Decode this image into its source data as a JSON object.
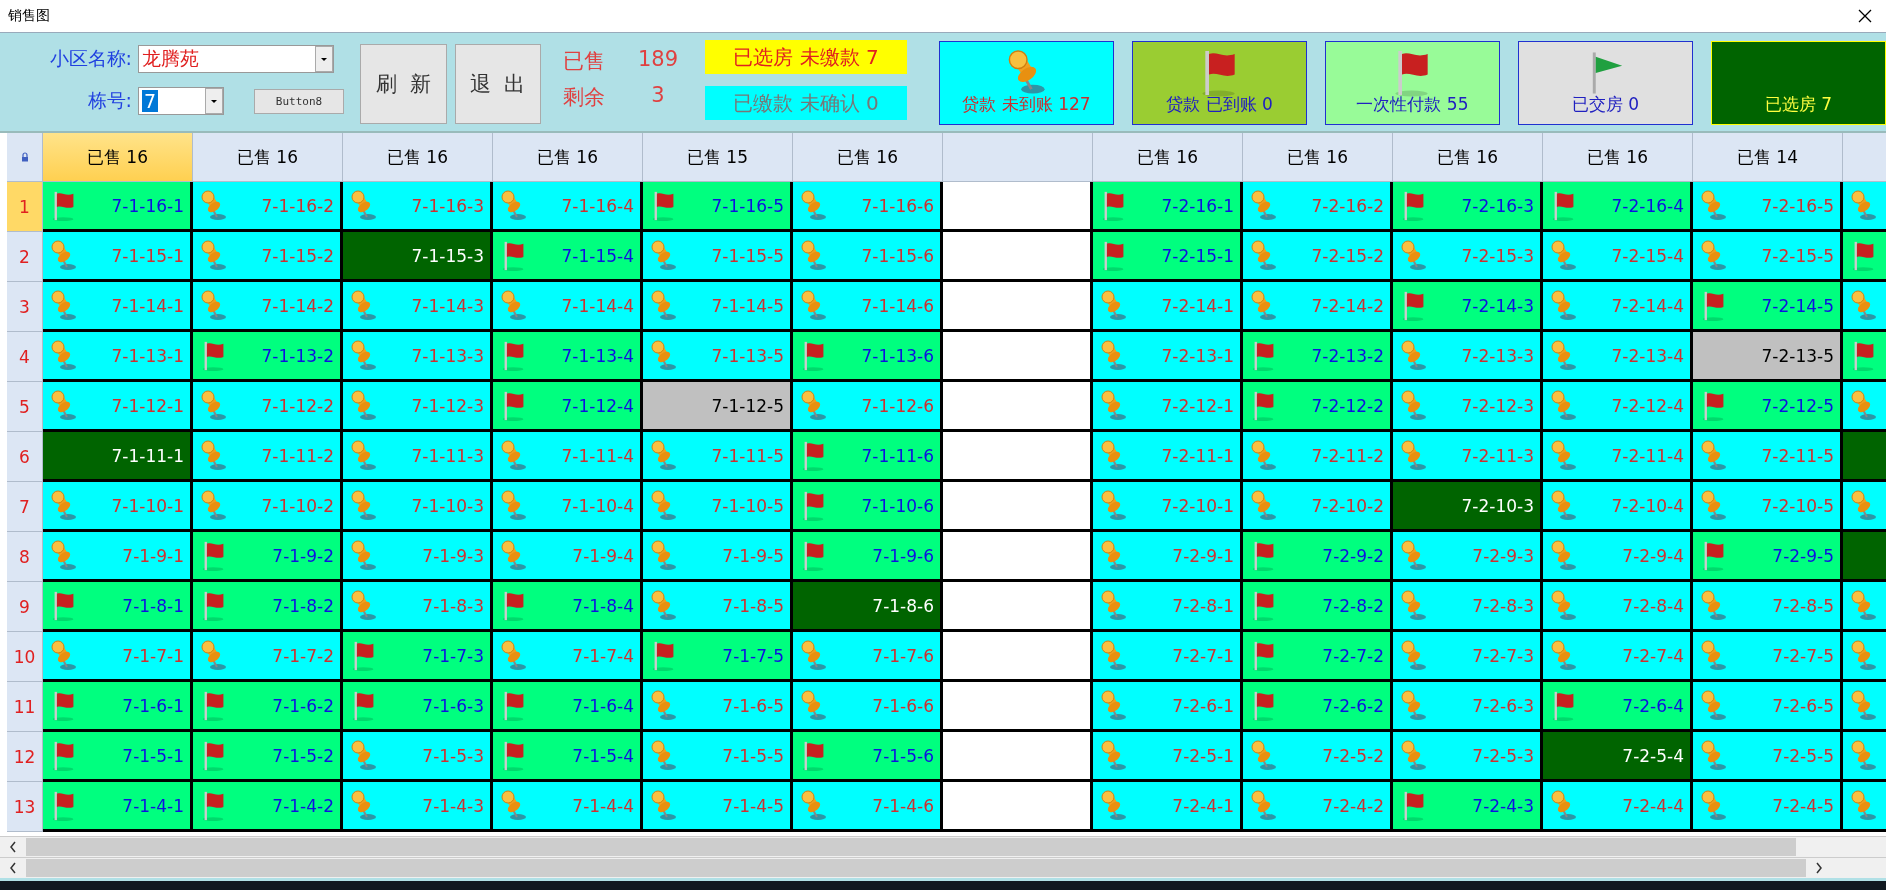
{
  "window": {
    "title": "销售图"
  },
  "toolbar": {
    "community": {
      "label": "小区名称:",
      "value": "龙腾苑"
    },
    "building": {
      "label": "栋号:",
      "value": "7",
      "focused": true
    },
    "buttons": [
      {
        "kind": "small",
        "label": "Button8"
      },
      {
        "kind": "large",
        "label": "刷 新"
      },
      {
        "kind": "large",
        "label": "退 出"
      }
    ],
    "stats": [
      {
        "label": "已售",
        "value": "189"
      },
      {
        "label": "剩余",
        "value": "3"
      }
    ],
    "notices": [
      {
        "kind": "unpaid",
        "text": "已选房 未缴款 7"
      },
      {
        "kind": "unconfirmed",
        "text": "已缴款 未确认 0"
      }
    ],
    "legend": [
      {
        "kind": "pin",
        "text": "贷款 未到账 127"
      },
      {
        "kind": "loanflag",
        "text": "贷款 已到账 0"
      },
      {
        "kind": "flag",
        "text": "一次性付款 55"
      },
      {
        "kind": "handed",
        "text": "已交房 0"
      },
      {
        "kind": "chosen",
        "text": "已选房 7"
      }
    ]
  },
  "grid": {
    "columns": [
      {
        "label": "已售 16",
        "selected": true
      },
      {
        "label": "已售 16",
        "selected": false
      },
      {
        "label": "已售 16",
        "selected": false
      },
      {
        "label": "已售 16",
        "selected": false
      },
      {
        "label": "已售 15",
        "selected": false
      },
      {
        "label": "已售 16",
        "selected": false
      },
      {
        "selected": false
      },
      {
        "label": "已售 16",
        "selected": false
      },
      {
        "label": "已售 16",
        "selected": false
      },
      {
        "label": "已售 16",
        "selected": false
      },
      {
        "label": "已售 16",
        "selected": false
      },
      {
        "label": "已售 14",
        "selected": false
      },
      {
        "selected": false
      }
    ],
    "rows": [
      {
        "number": "1",
        "selected": true,
        "cells": [
          {
            "kind": "flag",
            "label": "7-1-16-1"
          },
          {
            "kind": "pin",
            "label": "7-1-16-2"
          },
          {
            "kind": "pin",
            "label": "7-1-16-3"
          },
          {
            "kind": "pin",
            "label": "7-1-16-4"
          },
          {
            "kind": "flag",
            "label": "7-1-16-5"
          },
          {
            "kind": "pin",
            "label": "7-1-16-6"
          },
          {
            "kind": "empty"
          },
          {
            "kind": "flag",
            "label": "7-2-16-1"
          },
          {
            "kind": "pin",
            "label": "7-2-16-2"
          },
          {
            "kind": "flag",
            "label": "7-2-16-3"
          },
          {
            "kind": "flag",
            "label": "7-2-16-4"
          },
          {
            "kind": "pin",
            "label": "7-2-16-5"
          },
          {
            "kind": "pin"
          }
        ]
      },
      {
        "number": "2",
        "selected": false,
        "cells": [
          {
            "kind": "pin",
            "label": "7-1-15-1"
          },
          {
            "kind": "pin",
            "label": "7-1-15-2"
          },
          {
            "kind": "chosen",
            "label": "7-1-15-3"
          },
          {
            "kind": "flag",
            "label": "7-1-15-4"
          },
          {
            "kind": "pin",
            "label": "7-1-15-5"
          },
          {
            "kind": "pin",
            "label": "7-1-15-6"
          },
          {
            "kind": "empty"
          },
          {
            "kind": "flag",
            "label": "7-2-15-1"
          },
          {
            "kind": "pin",
            "label": "7-2-15-2"
          },
          {
            "kind": "pin",
            "label": "7-2-15-3"
          },
          {
            "kind": "pin",
            "label": "7-2-15-4"
          },
          {
            "kind": "pin",
            "label": "7-2-15-5"
          },
          {
            "kind": "flag"
          }
        ]
      },
      {
        "number": "3",
        "selected": false,
        "cells": [
          {
            "kind": "pin",
            "label": "7-1-14-1"
          },
          {
            "kind": "pin",
            "label": "7-1-14-2"
          },
          {
            "kind": "pin",
            "label": "7-1-14-3"
          },
          {
            "kind": "pin",
            "label": "7-1-14-4"
          },
          {
            "kind": "pin",
            "label": "7-1-14-5"
          },
          {
            "kind": "pin",
            "label": "7-1-14-6"
          },
          {
            "kind": "empty"
          },
          {
            "kind": "pin",
            "label": "7-2-14-1"
          },
          {
            "kind": "pin",
            "label": "7-2-14-2"
          },
          {
            "kind": "flag",
            "label": "7-2-14-3"
          },
          {
            "kind": "pin",
            "label": "7-2-14-4"
          },
          {
            "kind": "flag",
            "label": "7-2-14-5"
          },
          {
            "kind": "pin"
          }
        ]
      },
      {
        "number": "4",
        "selected": false,
        "cells": [
          {
            "kind": "pin",
            "label": "7-1-13-1"
          },
          {
            "kind": "flag",
            "label": "7-1-13-2"
          },
          {
            "kind": "pin",
            "label": "7-1-13-3"
          },
          {
            "kind": "flag",
            "label": "7-1-13-4"
          },
          {
            "kind": "pin",
            "label": "7-1-13-5"
          },
          {
            "kind": "flag",
            "label": "7-1-13-6"
          },
          {
            "kind": "empty"
          },
          {
            "kind": "pin",
            "label": "7-2-13-1"
          },
          {
            "kind": "flag",
            "label": "7-2-13-2"
          },
          {
            "kind": "pin",
            "label": "7-2-13-3"
          },
          {
            "kind": "pin",
            "label": "7-2-13-4"
          },
          {
            "kind": "grey",
            "label": "7-2-13-5"
          },
          {
            "kind": "flag"
          }
        ]
      },
      {
        "number": "5",
        "selected": false,
        "cells": [
          {
            "kind": "pin",
            "label": "7-1-12-1"
          },
          {
            "kind": "pin",
            "label": "7-1-12-2"
          },
          {
            "kind": "pin",
            "label": "7-1-12-3"
          },
          {
            "kind": "flag",
            "label": "7-1-12-4"
          },
          {
            "kind": "grey",
            "label": "7-1-12-5"
          },
          {
            "kind": "pin",
            "label": "7-1-12-6"
          },
          {
            "kind": "empty"
          },
          {
            "kind": "pin",
            "label": "7-2-12-1"
          },
          {
            "kind": "flag",
            "label": "7-2-12-2"
          },
          {
            "kind": "pin",
            "label": "7-2-12-3"
          },
          {
            "kind": "pin",
            "label": "7-2-12-4"
          },
          {
            "kind": "flag",
            "label": "7-2-12-5"
          },
          {
            "kind": "pin"
          }
        ]
      },
      {
        "number": "6",
        "selected": false,
        "cells": [
          {
            "kind": "chosen",
            "label": "7-1-11-1"
          },
          {
            "kind": "pin",
            "label": "7-1-11-2"
          },
          {
            "kind": "pin",
            "label": "7-1-11-3"
          },
          {
            "kind": "pin",
            "label": "7-1-11-4"
          },
          {
            "kind": "pin",
            "label": "7-1-11-5"
          },
          {
            "kind": "flag",
            "label": "7-1-11-6"
          },
          {
            "kind": "empty"
          },
          {
            "kind": "pin",
            "label": "7-2-11-1"
          },
          {
            "kind": "pin",
            "label": "7-2-11-2"
          },
          {
            "kind": "pin",
            "label": "7-2-11-3"
          },
          {
            "kind": "pin",
            "label": "7-2-11-4"
          },
          {
            "kind": "pin",
            "label": "7-2-11-5"
          },
          {
            "kind": "chosen"
          }
        ]
      },
      {
        "number": "7",
        "selected": false,
        "cells": [
          {
            "kind": "pin",
            "label": "7-1-10-1"
          },
          {
            "kind": "pin",
            "label": "7-1-10-2"
          },
          {
            "kind": "pin",
            "label": "7-1-10-3"
          },
          {
            "kind": "pin",
            "label": "7-1-10-4"
          },
          {
            "kind": "pin",
            "label": "7-1-10-5"
          },
          {
            "kind": "flag",
            "label": "7-1-10-6"
          },
          {
            "kind": "empty"
          },
          {
            "kind": "pin",
            "label": "7-2-10-1"
          },
          {
            "kind": "pin",
            "label": "7-2-10-2"
          },
          {
            "kind": "chosen",
            "label": "7-2-10-3"
          },
          {
            "kind": "pin",
            "label": "7-2-10-4"
          },
          {
            "kind": "pin",
            "label": "7-2-10-5"
          },
          {
            "kind": "pin"
          }
        ]
      },
      {
        "number": "8",
        "selected": false,
        "cells": [
          {
            "kind": "pin",
            "label": "7-1-9-1"
          },
          {
            "kind": "flag",
            "label": "7-1-9-2"
          },
          {
            "kind": "pin",
            "label": "7-1-9-3"
          },
          {
            "kind": "pin",
            "label": "7-1-9-4"
          },
          {
            "kind": "pin",
            "label": "7-1-9-5"
          },
          {
            "kind": "flag",
            "label": "7-1-9-6"
          },
          {
            "kind": "empty"
          },
          {
            "kind": "pin",
            "label": "7-2-9-1"
          },
          {
            "kind": "flag",
            "label": "7-2-9-2"
          },
          {
            "kind": "pin",
            "label": "7-2-9-3"
          },
          {
            "kind": "pin",
            "label": "7-2-9-4"
          },
          {
            "kind": "flag",
            "label": "7-2-9-5"
          },
          {
            "kind": "chosen"
          }
        ]
      },
      {
        "number": "9",
        "selected": false,
        "cells": [
          {
            "kind": "flag",
            "label": "7-1-8-1"
          },
          {
            "kind": "flag",
            "label": "7-1-8-2"
          },
          {
            "kind": "pin",
            "label": "7-1-8-3"
          },
          {
            "kind": "flag",
            "label": "7-1-8-4"
          },
          {
            "kind": "pin",
            "label": "7-1-8-5"
          },
          {
            "kind": "chosen",
            "label": "7-1-8-6"
          },
          {
            "kind": "empty"
          },
          {
            "kind": "pin",
            "label": "7-2-8-1"
          },
          {
            "kind": "flag",
            "label": "7-2-8-2"
          },
          {
            "kind": "pin",
            "label": "7-2-8-3"
          },
          {
            "kind": "pin",
            "label": "7-2-8-4"
          },
          {
            "kind": "pin",
            "label": "7-2-8-5"
          },
          {
            "kind": "pin"
          }
        ]
      },
      {
        "number": "10",
        "selected": false,
        "cells": [
          {
            "kind": "pin",
            "label": "7-1-7-1"
          },
          {
            "kind": "pin",
            "label": "7-1-7-2"
          },
          {
            "kind": "flag",
            "label": "7-1-7-3"
          },
          {
            "kind": "pin",
            "label": "7-1-7-4"
          },
          {
            "kind": "flag",
            "label": "7-1-7-5"
          },
          {
            "kind": "pin",
            "label": "7-1-7-6"
          },
          {
            "kind": "empty"
          },
          {
            "kind": "pin",
            "label": "7-2-7-1"
          },
          {
            "kind": "flag",
            "label": "7-2-7-2"
          },
          {
            "kind": "pin",
            "label": "7-2-7-3"
          },
          {
            "kind": "pin",
            "label": "7-2-7-4"
          },
          {
            "kind": "pin",
            "label": "7-2-7-5"
          },
          {
            "kind": "pin"
          }
        ]
      },
      {
        "number": "11",
        "selected": false,
        "cells": [
          {
            "kind": "flag",
            "label": "7-1-6-1"
          },
          {
            "kind": "flag",
            "label": "7-1-6-2"
          },
          {
            "kind": "flag",
            "label": "7-1-6-3"
          },
          {
            "kind": "flag",
            "label": "7-1-6-4"
          },
          {
            "kind": "pin",
            "label": "7-1-6-5"
          },
          {
            "kind": "pin",
            "label": "7-1-6-6"
          },
          {
            "kind": "empty"
          },
          {
            "kind": "pin",
            "label": "7-2-6-1"
          },
          {
            "kind": "flag",
            "label": "7-2-6-2"
          },
          {
            "kind": "pin",
            "label": "7-2-6-3"
          },
          {
            "kind": "flag",
            "label": "7-2-6-4"
          },
          {
            "kind": "pin",
            "label": "7-2-6-5"
          },
          {
            "kind": "pin"
          }
        ]
      },
      {
        "number": "12",
        "selected": false,
        "cells": [
          {
            "kind": "flag",
            "label": "7-1-5-1"
          },
          {
            "kind": "flag",
            "label": "7-1-5-2"
          },
          {
            "kind": "pin",
            "label": "7-1-5-3"
          },
          {
            "kind": "flag",
            "label": "7-1-5-4"
          },
          {
            "kind": "pin",
            "label": "7-1-5-5"
          },
          {
            "kind": "flag",
            "label": "7-1-5-6"
          },
          {
            "kind": "empty"
          },
          {
            "kind": "pin",
            "label": "7-2-5-1"
          },
          {
            "kind": "pin",
            "label": "7-2-5-2"
          },
          {
            "kind": "pin",
            "label": "7-2-5-3"
          },
          {
            "kind": "chosen",
            "label": "7-2-5-4"
          },
          {
            "kind": "pin",
            "label": "7-2-5-5"
          },
          {
            "kind": "pin"
          }
        ]
      },
      {
        "number": "13",
        "selected": false,
        "cells": [
          {
            "kind": "flag",
            "label": "7-1-4-1"
          },
          {
            "kind": "flag",
            "label": "7-1-4-2"
          },
          {
            "kind": "pin",
            "label": "7-1-4-3"
          },
          {
            "kind": "pin",
            "label": "7-1-4-4"
          },
          {
            "kind": "pin",
            "label": "7-1-4-5"
          },
          {
            "kind": "pin",
            "label": "7-1-4-6"
          },
          {
            "kind": "empty"
          },
          {
            "kind": "pin",
            "label": "7-2-4-1"
          },
          {
            "kind": "pin",
            "label": "7-2-4-2"
          },
          {
            "kind": "flag",
            "label": "7-2-4-3"
          },
          {
            "kind": "pin",
            "label": "7-2-4-4"
          },
          {
            "kind": "pin",
            "label": "7-2-4-5"
          },
          {
            "kind": "pin"
          }
        ]
      }
    ]
  }
}
